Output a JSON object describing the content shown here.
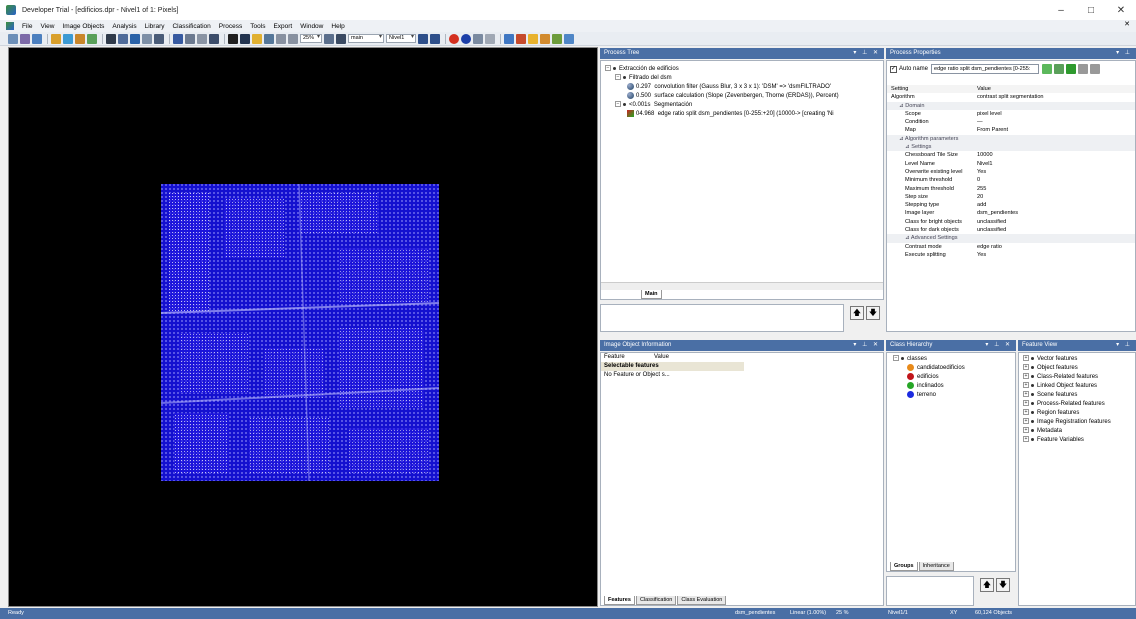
{
  "window": {
    "title": "Developer Trial - [edificios.dpr - Nivel1 of 1: Pixels]",
    "controls": [
      "–",
      "□",
      "✕"
    ]
  },
  "menu": [
    "File",
    "View",
    "Image Objects",
    "Analysis",
    "Library",
    "Classification",
    "Process",
    "Tools",
    "Export",
    "Window",
    "Help"
  ],
  "menu_close": "✕",
  "toolbar": {
    "zoom": "25%",
    "map": "main",
    "level": "Nivel1"
  },
  "process_tree": {
    "title": "Process Tree",
    "controls": "▾ ⊥ ✕",
    "items": [
      {
        "prefix": "",
        "text": "Extracción de edificios"
      },
      {
        "prefix": "",
        "text": "Filtrado del dsm"
      },
      {
        "prefix": "0.297",
        "text": "convolution filter (Gauss Blur, 3 x 3 x 1): 'DSM' => 'dsmFILTRADO'"
      },
      {
        "prefix": "0.500",
        "text": "surface calculation (Slope (Zevenbergen, Thorne (ERDAS)), Percent)"
      },
      {
        "prefix": "<0.001s",
        "text": "Segmentación"
      },
      {
        "prefix": "04.968",
        "text": "edge ratio split dsm_pendientes [0-255:+20] (10000-> [creating 'Ni"
      }
    ],
    "tab": "Main",
    "up": "🡅",
    "down": "🡇"
  },
  "process_properties": {
    "title": "Process Properties",
    "controls": "▾ ⊥",
    "auto_name_label": "Auto name",
    "auto_name_value": "edge ratio split dsm_pendientes [0-255:",
    "header": {
      "k": "Setting",
      "v": "Value"
    },
    "rows": [
      {
        "k": "Algorithm",
        "v": "contrast split segmentation",
        "g": 0
      },
      {
        "k": "⊿ Domain",
        "v": "",
        "g": 1
      },
      {
        "k": "Scope",
        "v": "pixel level",
        "g": 0
      },
      {
        "k": "Condition",
        "v": "—",
        "g": 0
      },
      {
        "k": "Map",
        "v": "From Parent",
        "g": 0
      },
      {
        "k": "⊿ Algorithm parameters",
        "v": "",
        "g": 1
      },
      {
        "k": "⊿ Settings",
        "v": "",
        "g": 2
      },
      {
        "k": "Chessboard Tile Size",
        "v": "10000",
        "g": 0
      },
      {
        "k": "Level Name",
        "v": "Nivel1",
        "g": 0
      },
      {
        "k": "Overwrite existing level",
        "v": "Yes",
        "g": 0
      },
      {
        "k": "Minimum threshold",
        "v": "0",
        "g": 0
      },
      {
        "k": "Maximum threshold",
        "v": "255",
        "g": 0
      },
      {
        "k": "Step size",
        "v": "20",
        "g": 0
      },
      {
        "k": "Stepping type",
        "v": "add",
        "g": 0
      },
      {
        "k": "Image layer",
        "v": "dsm_pendientes",
        "g": 0
      },
      {
        "k": "Class for bright objects",
        "v": "unclassified",
        "g": 0
      },
      {
        "k": "Class for dark objects",
        "v": "unclassified",
        "g": 0
      },
      {
        "k": "⊿ Advanced Settings",
        "v": "",
        "g": 2
      },
      {
        "k": "Contrast mode",
        "v": "edge ratio",
        "g": 0
      },
      {
        "k": "Execute splitting",
        "v": "Yes",
        "g": 0
      }
    ]
  },
  "image_object_info": {
    "title": "Image Object Information",
    "controls": "▾ ⊥ ✕",
    "col_feature": "Feature",
    "col_value": "Value",
    "group": "Selectable features",
    "message": "No Feature or Object s...",
    "tabs": [
      "Features",
      "Classification",
      "Class Evaluation"
    ]
  },
  "class_hierarchy": {
    "title": "Class Hierarchy",
    "controls": "▾ ⊥ ✕",
    "root": "classes",
    "classes": [
      {
        "name": "candidatoedificios",
        "color": "#e88a1a"
      },
      {
        "name": "edificios",
        "color": "#c0151b"
      },
      {
        "name": "inclinados",
        "color": "#26a626"
      },
      {
        "name": "terreno",
        "color": "#1c2be0"
      }
    ],
    "tabs": [
      "Groups",
      "Inheritance"
    ]
  },
  "feature_view": {
    "title": "Feature View",
    "controls": "▾ ⊥",
    "items": [
      "Vector features",
      "Object features",
      "Class-Related features",
      "Linked Object features",
      "Scene features",
      "Process-Related features",
      "Region features",
      "Image Registration features",
      "Metadata",
      "Feature Variables"
    ]
  },
  "status": {
    "left": "Ready",
    "layer": "dsm_pendientes",
    "mode": "Linear (1.00%)",
    "zoom": "25 %",
    "level": "Nivel1/1",
    "xy": "XY",
    "objects": "60,124 Objects"
  }
}
